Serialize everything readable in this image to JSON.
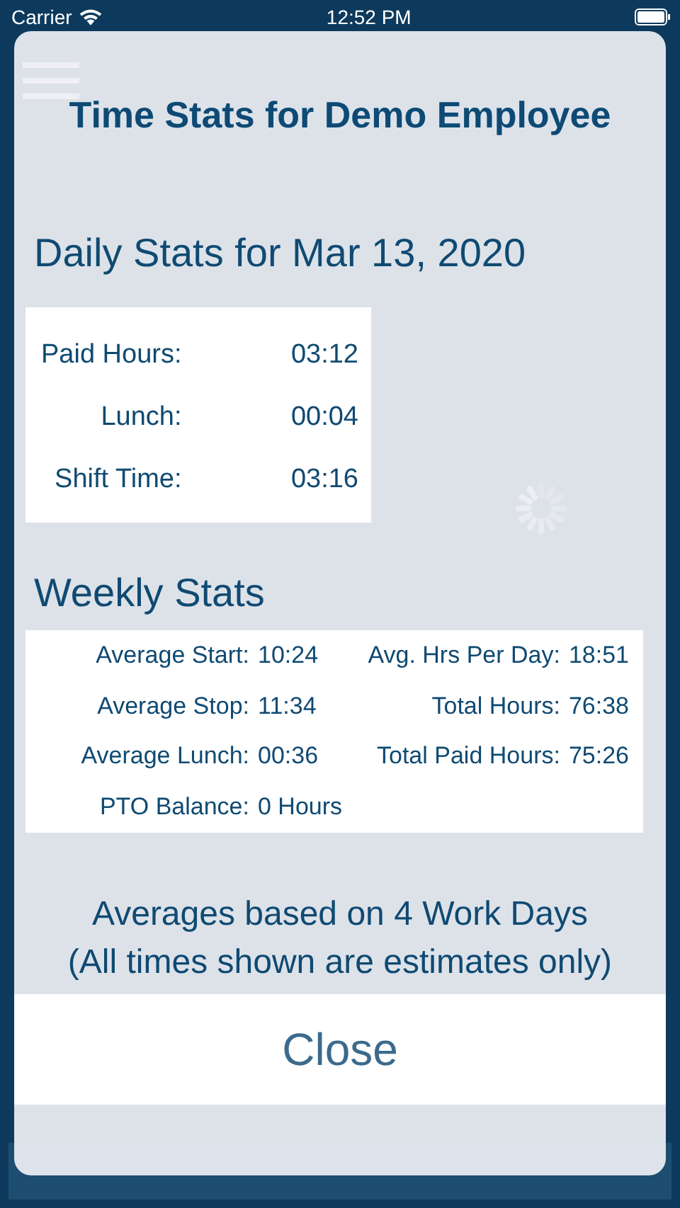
{
  "status_bar": {
    "carrier": "Carrier",
    "time": "12:52 PM"
  },
  "dialog": {
    "title": "Time Stats for Demo Employee",
    "daily": {
      "heading": "Daily Stats for Mar 13, 2020",
      "rows": [
        {
          "label": "Paid Hours:",
          "value": "03:12"
        },
        {
          "label": "Lunch:",
          "value": "00:04"
        },
        {
          "label": "Shift Time:",
          "value": "03:16"
        }
      ]
    },
    "weekly": {
      "heading": "Weekly Stats",
      "rows": [
        {
          "label": "Average Start:",
          "value": "10:24",
          "label_2": "Avg. Hrs Per Day:",
          "value_2": "18:51"
        },
        {
          "label": "Average Stop:",
          "value": "11:34",
          "label_2": "Total Hours:",
          "value_2": "76:38"
        },
        {
          "label": "Average Lunch:",
          "value": "00:36",
          "label_2": "Total Paid Hours:",
          "value_2": "75:26"
        },
        {
          "label": "PTO Balance:",
          "value": "0 Hours"
        }
      ]
    },
    "notes": [
      "Averages based on 4 Work Days",
      "(All times shown are estimates only)"
    ],
    "close_button": "Close"
  }
}
